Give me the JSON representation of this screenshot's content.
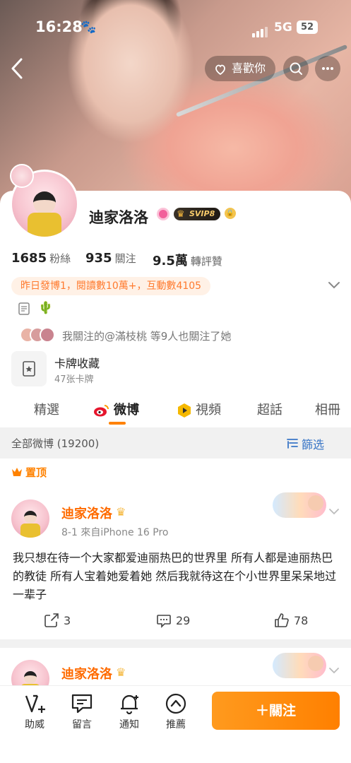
{
  "status_bar": {
    "time": "16:28",
    "network": "5G",
    "battery": "52"
  },
  "header": {
    "like_label": "喜歡你"
  },
  "profile": {
    "username": "迪家洛洛",
    "svip_label": "SVIP8",
    "stats": [
      {
        "value": "1685",
        "label": "粉絲"
      },
      {
        "value": "935",
        "label": "關注"
      },
      {
        "value": "9.5萬",
        "label": "轉評贊"
      }
    ],
    "activity": "昨日發博1，閱讀數10萬+，互動數4105",
    "mutual_text": "我關注的@滿枝桃  等9人也關注了她",
    "card_collection": {
      "title": "卡牌收藏",
      "subtitle": "47张卡牌"
    }
  },
  "tabs": [
    {
      "label": "精選",
      "active": false
    },
    {
      "label": "微博",
      "active": true
    },
    {
      "label": "視頻",
      "active": false
    },
    {
      "label": "超話",
      "active": false
    },
    {
      "label": "相冊",
      "active": false
    }
  ],
  "filter": {
    "count_label": "全部微博 (19200)",
    "filter_label": "篩选"
  },
  "pinned_label": "置顶",
  "post": {
    "author": "迪家洛洛",
    "meta": "8-1  來自iPhone 16 Pro",
    "text": "我只想在待一个大家都爱迪丽热巴的世界里 所有人都是迪丽热巴的教徒 所有人宝着她爱着她 然后我就待这在个小世界里呆呆地过一辈子",
    "reposts": "3",
    "comments": "29",
    "likes": "78"
  },
  "post2": {
    "author": "迪家洛洛"
  },
  "bottom_nav": {
    "items": [
      "助威",
      "留言",
      "通知",
      "推薦"
    ],
    "follow_label": "＋關注"
  },
  "colors": {
    "accent": "#ff8200",
    "link": "#3a76c6",
    "author": "#ff6b00"
  }
}
